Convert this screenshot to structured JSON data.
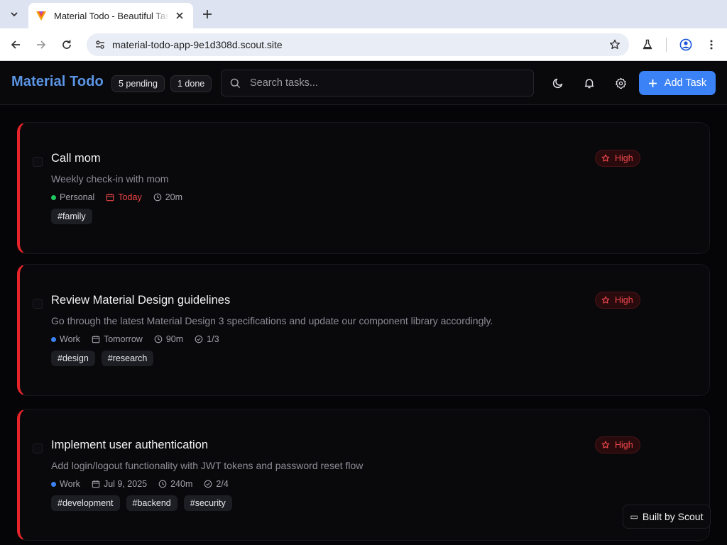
{
  "browser": {
    "tab_title": "Material Todo - Beautiful Task Manager",
    "url": "material-todo-app-9e1d308d.scout.site"
  },
  "header": {
    "brand": "Material Todo",
    "pending_badge": "5 pending",
    "done_badge": "1 done",
    "search_placeholder": "Search tasks...",
    "add_task_label": "Add Task"
  },
  "tasks": [
    {
      "title": "Call mom",
      "description": "Weekly check-in with mom",
      "category": "Personal",
      "category_color": "#22c55e",
      "due": "Today",
      "duration": "20m",
      "subtasks": "",
      "priority": "High",
      "tags": [
        "#family"
      ]
    },
    {
      "title": "Review Material Design guidelines",
      "description": "Go through the latest Material Design 3 specifications and update our component library accordingly.",
      "category": "Work",
      "category_color": "#3b82f6",
      "due": "Tomorrow",
      "duration": "90m",
      "subtasks": "1/3",
      "priority": "High",
      "tags": [
        "#design",
        "#research"
      ]
    },
    {
      "title": "Implement user authentication",
      "description": "Add login/logout functionality with JWT tokens and password reset flow",
      "category": "Work",
      "category_color": "#3b82f6",
      "due": "Jul 9, 2025",
      "duration": "240m",
      "subtasks": "2/4",
      "priority": "High",
      "tags": [
        "#development",
        "#backend",
        "#security"
      ]
    }
  ],
  "footer": {
    "built_by": "Built by Scout"
  },
  "colors": {
    "brand": "#5b95e6",
    "accent": "#3b82f6",
    "priority_high": "#f0474c",
    "due_today": "#ef4444"
  }
}
